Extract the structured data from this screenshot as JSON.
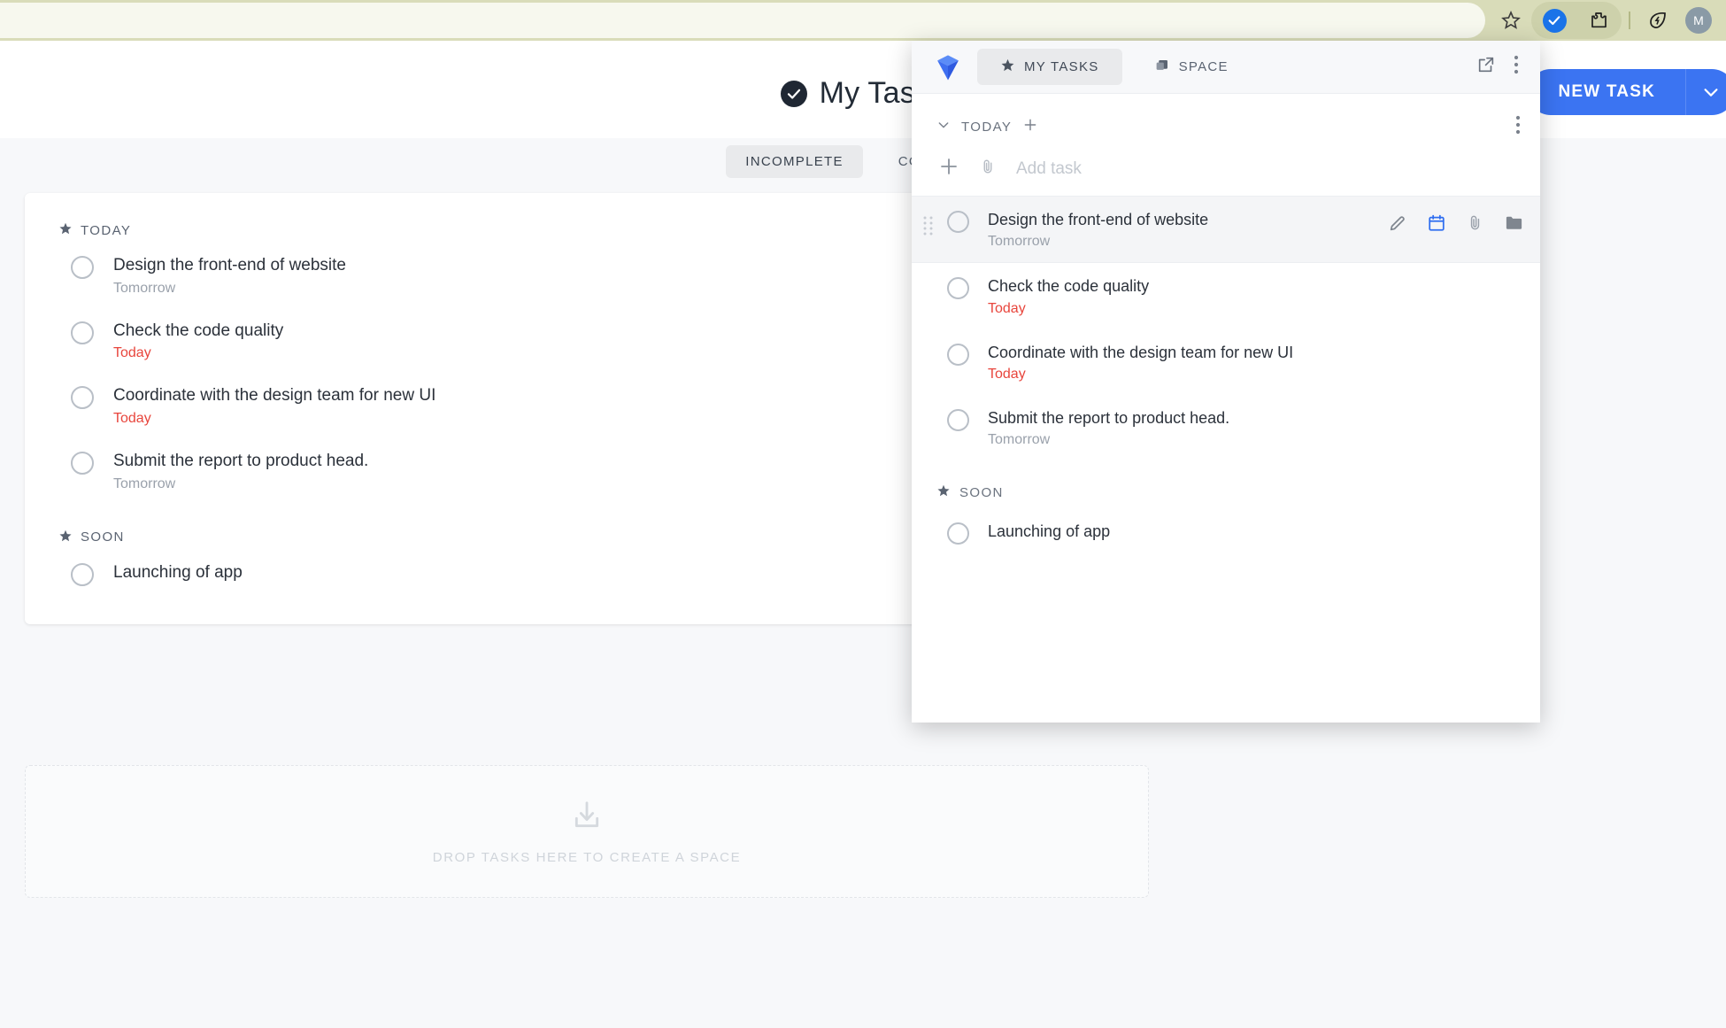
{
  "browser": {
    "icons": {
      "bookmark": "star-icon",
      "extension_active": "checkmark-extension-icon",
      "puzzle": "puzzle-piece-icon",
      "leaf": "leaf-bolt-icon",
      "avatar_initial": "M"
    }
  },
  "page": {
    "title": "My Tasks",
    "new_task_label": "NEW TASK",
    "tabs": [
      {
        "label": "INCOMPLETE",
        "active": true
      },
      {
        "label": "COMPLETE",
        "active": false
      }
    ],
    "sections": [
      {
        "name": "TODAY",
        "tasks": [
          {
            "title": "Design the front-end of website",
            "date": "Tomorrow",
            "due_today": false
          },
          {
            "title": "Check the code quality",
            "date": "Today",
            "due_today": true
          },
          {
            "title": "Coordinate with the design team for new UI",
            "date": "Today",
            "due_today": true
          },
          {
            "title": "Submit the report to product head.",
            "date": "Tomorrow",
            "due_today": false
          }
        ]
      },
      {
        "name": "SOON",
        "tasks": [
          {
            "title": "Launching of app",
            "date": "",
            "due_today": false
          }
        ]
      }
    ],
    "dropzone_text": "DROP TASKS HERE TO CREATE A SPACE"
  },
  "popup": {
    "tabs": [
      {
        "label": "MY TASKS",
        "active": true
      },
      {
        "label": "SPACE",
        "active": false
      }
    ],
    "section_today": "TODAY",
    "section_soon": "SOON",
    "add_task_placeholder": "Add task",
    "tasks_today": [
      {
        "title": "Design the front-end of website",
        "date": "Tomorrow",
        "due_today": false,
        "hovered": true
      },
      {
        "title": "Check the code quality",
        "date": "Today",
        "due_today": true,
        "hovered": false
      },
      {
        "title": "Coordinate with the design team for new UI",
        "date": "Today",
        "due_today": true,
        "hovered": false
      },
      {
        "title": "Submit the report to product head.",
        "date": "Tomorrow",
        "due_today": false,
        "hovered": false
      }
    ],
    "tasks_soon": [
      {
        "title": "Launching of app",
        "date": "",
        "due_today": false,
        "hovered": false
      }
    ],
    "row_actions": [
      "edit-pencil-icon",
      "calendar-icon",
      "attachment-icon",
      "folder-icon"
    ]
  },
  "colors": {
    "accent_blue": "#3b74f2",
    "due_red": "#e8453c",
    "browser_bar": "#d9dcb9",
    "popup_hover": "#f4f5f7"
  }
}
